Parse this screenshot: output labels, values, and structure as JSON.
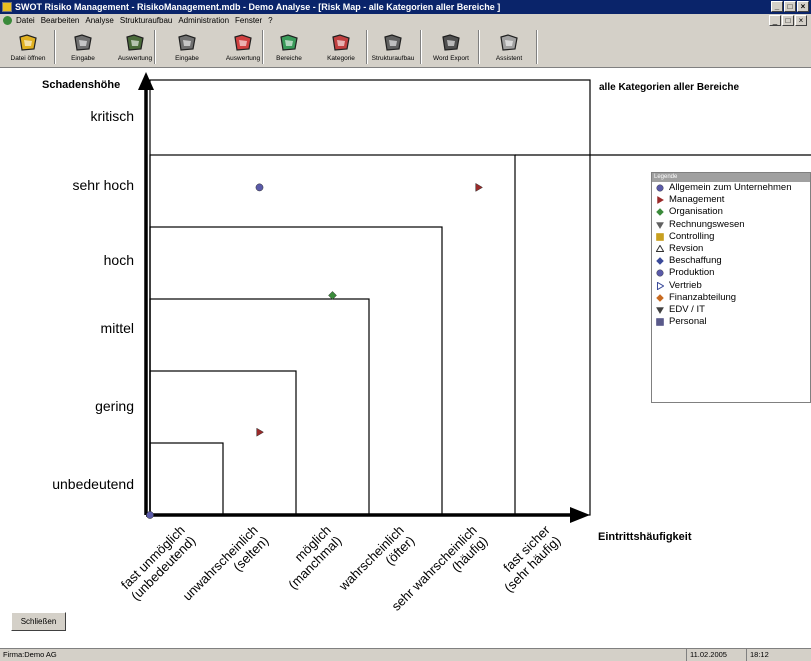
{
  "window": {
    "title": "SWOT Risiko Management - RisikoManagement.mdb - Demo Analyse - [Risk Map - alle Kategorien aller Bereiche ]"
  },
  "menu": [
    "Datei",
    "Bearbeiten",
    "Analyse",
    "Strukturaufbau",
    "Administration",
    "Fenster",
    "?"
  ],
  "toolbar": [
    {
      "label": "Datei öffnen",
      "icon": "folder-open-icon"
    },
    {
      "label": "Eingabe",
      "icon": "input-icon"
    },
    {
      "label": "Auswertung",
      "icon": "evaluation-icon"
    },
    {
      "label": "Eingabe",
      "icon": "input-icon"
    },
    {
      "label": "Auswertung",
      "icon": "evaluation-icon"
    },
    {
      "label": "Bereiche",
      "icon": "areas-icon"
    },
    {
      "label": "Kategorie",
      "icon": "category-icon"
    },
    {
      "label": "Strukturaufbau",
      "icon": "structure-icon"
    },
    {
      "label": "Word Export",
      "icon": "word-export-icon"
    },
    {
      "label": "Assistent",
      "icon": "wizard-icon"
    }
  ],
  "chart_data": {
    "type": "scatter",
    "title": "alle Kategorien aller Bereiche",
    "ylabel": "Schadenshöhe",
    "xlabel": "Eintrittshäufigkeit",
    "y_categories": [
      "unbedeutend",
      "gering",
      "mittel",
      "hoch",
      "sehr hoch",
      "kritisch"
    ],
    "x_categories": [
      [
        "fast unmöglich",
        "(unbedeutend)"
      ],
      [
        "unwahrscheinlich",
        "(selten)"
      ],
      [
        "möglich",
        "(manchmal)"
      ],
      [
        "wahrscheinlich",
        "(öfter)"
      ],
      [
        "sehr wahrscheinlich",
        "(häufig)"
      ],
      [
        "fast sicher",
        "(sehr häufig)"
      ]
    ],
    "points": [
      {
        "category": "Allgemein zum Unternehmen",
        "x": 0,
        "y": 0
      },
      {
        "category": "Allgemein zum Unternehmen",
        "x": 1.5,
        "y": 4.55
      },
      {
        "category": "Management",
        "x": 4.5,
        "y": 4.55
      },
      {
        "category": "Organisation",
        "x": 2.5,
        "y": 3.05
      },
      {
        "category": "Management",
        "x": 1.5,
        "y": 1.15
      }
    ],
    "legend_title": "Legende",
    "legend": [
      {
        "name": "Allgemein zum Unternehmen",
        "symbol": "circle",
        "color": "#5a5aa8"
      },
      {
        "name": "Management",
        "symbol": "triangle-right",
        "color": "#9a2a2a"
      },
      {
        "name": "Organisation",
        "symbol": "diamond",
        "color": "#3a8a3a"
      },
      {
        "name": "Rechnungswesen",
        "symbol": "triangle-down",
        "color": "#606060"
      },
      {
        "name": "Controlling",
        "symbol": "square",
        "color": "#c8a020"
      },
      {
        "name": "Revsion",
        "symbol": "triangle-up-outline",
        "color": "#303030"
      },
      {
        "name": "Beschaffung",
        "symbol": "diamond",
        "color": "#3a4a9a"
      },
      {
        "name": "Produktion",
        "symbol": "circle",
        "color": "#5a5aa8"
      },
      {
        "name": "Vertrieb",
        "symbol": "triangle-right-outline",
        "color": "#3a4a9a"
      },
      {
        "name": "Finanzabteilung",
        "symbol": "diamond",
        "color": "#c86a20"
      },
      {
        "name": "EDV / IT",
        "symbol": "triangle-down",
        "color": "#404040"
      },
      {
        "name": "Personal",
        "symbol": "square",
        "color": "#5a5a8a"
      }
    ]
  },
  "buttons": {
    "close": "Schließen"
  },
  "status": {
    "company": "Firma:Demo AG",
    "date": "11.02.2005",
    "time": "18:12"
  }
}
